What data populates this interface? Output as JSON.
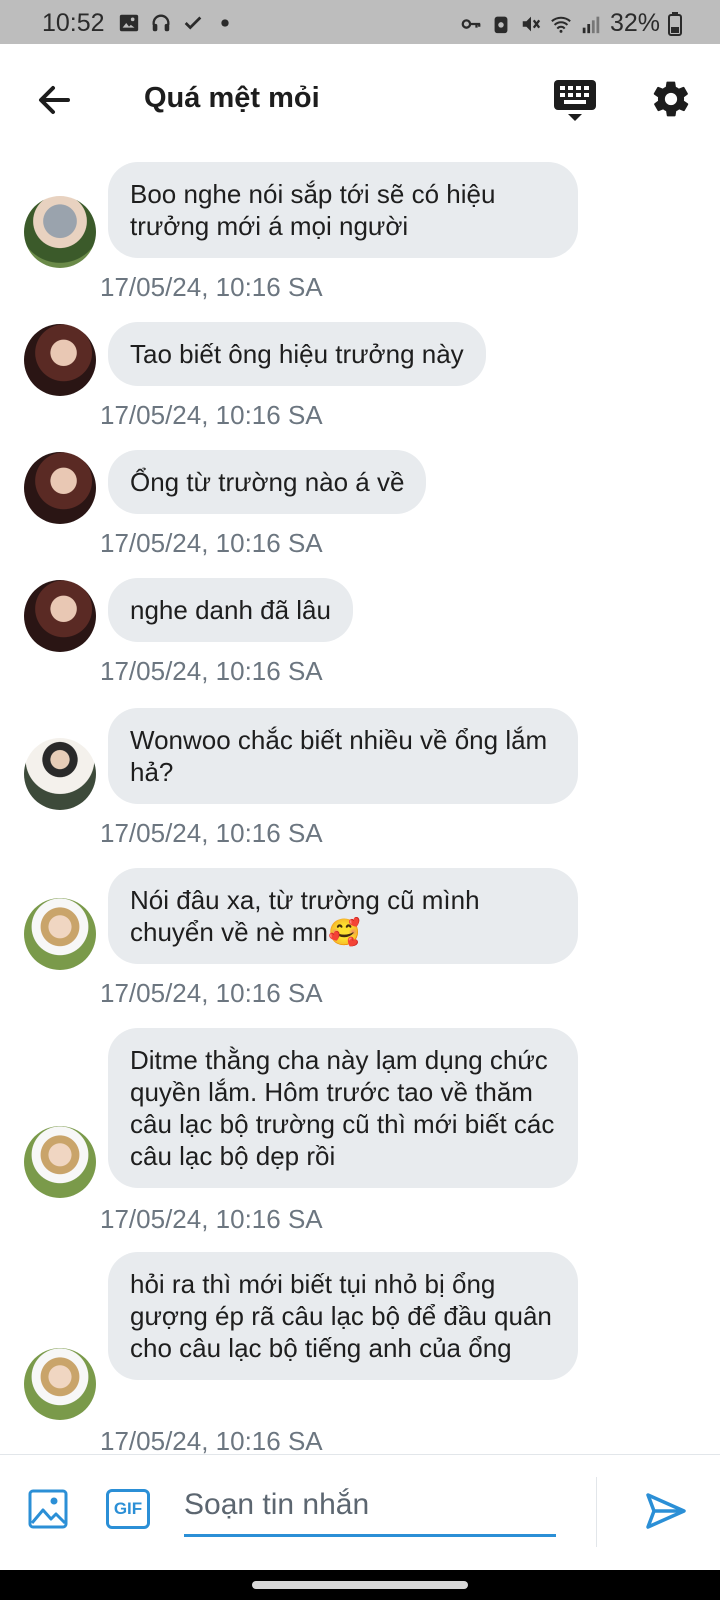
{
  "status_bar": {
    "time": "10:52",
    "battery": "32%",
    "left_icons": [
      "image-icon",
      "headphones-icon",
      "check-icon",
      "dot-icon"
    ],
    "right_icons": [
      "key-icon",
      "lock-icon",
      "mute-icon",
      "wifi-icon",
      "signal-icon",
      "battery-icon"
    ]
  },
  "header": {
    "title": "Quá mệt mỏi"
  },
  "messages": [
    {
      "text": "Boo nghe nói sắp tới sẽ có hiệu trưởng mới á mọi người",
      "time": "17/05/24, 10:16 SA",
      "avatar": "avatar-gray-hair"
    },
    {
      "text": "Tao biết ông hiệu trưởng này",
      "time": "17/05/24, 10:16 SA",
      "avatar": "avatar-red-hair"
    },
    {
      "text": "Ổng từ trường nào á về",
      "time": "17/05/24, 10:16 SA",
      "avatar": "avatar-red-hair"
    },
    {
      "text": "nghe danh đã lâu",
      "time": "17/05/24, 10:16 SA",
      "avatar": "avatar-red-hair"
    },
    {
      "text": "Wonwoo chắc biết nhiều về ổng lắm hả?",
      "time": "17/05/24, 10:16 SA",
      "avatar": "avatar-white-shirt"
    },
    {
      "text": "Nói đâu xa, từ trường cũ mình chuyển về nè mn🥰",
      "time": "17/05/24, 10:16 SA",
      "avatar": "avatar-outdoor"
    },
    {
      "text": "Ditme thằng cha này lạm dụng chức quyền lắm. Hôm trước tao về thăm câu lạc bộ trường cũ thì mới biết các câu lạc bộ dẹp rồi",
      "time": "17/05/24, 10:16 SA",
      "avatar": "avatar-outdoor"
    },
    {
      "text": "hỏi ra thì mới biết tụi nhỏ bị ổng gượng ép rã câu lạc bộ để đầu quân cho câu lạc bộ tiếng anh của ổng",
      "time": "17/05/24, 10:16 SA",
      "avatar": "avatar-outdoor"
    }
  ],
  "composer": {
    "placeholder": "Soạn tin nhắn",
    "gif_label": "GIF"
  },
  "colors": {
    "accent": "#2b8fd6",
    "bubble": "#e8ebee",
    "timestamp": "#6c7680",
    "status_bar": "#bdbdbd"
  }
}
